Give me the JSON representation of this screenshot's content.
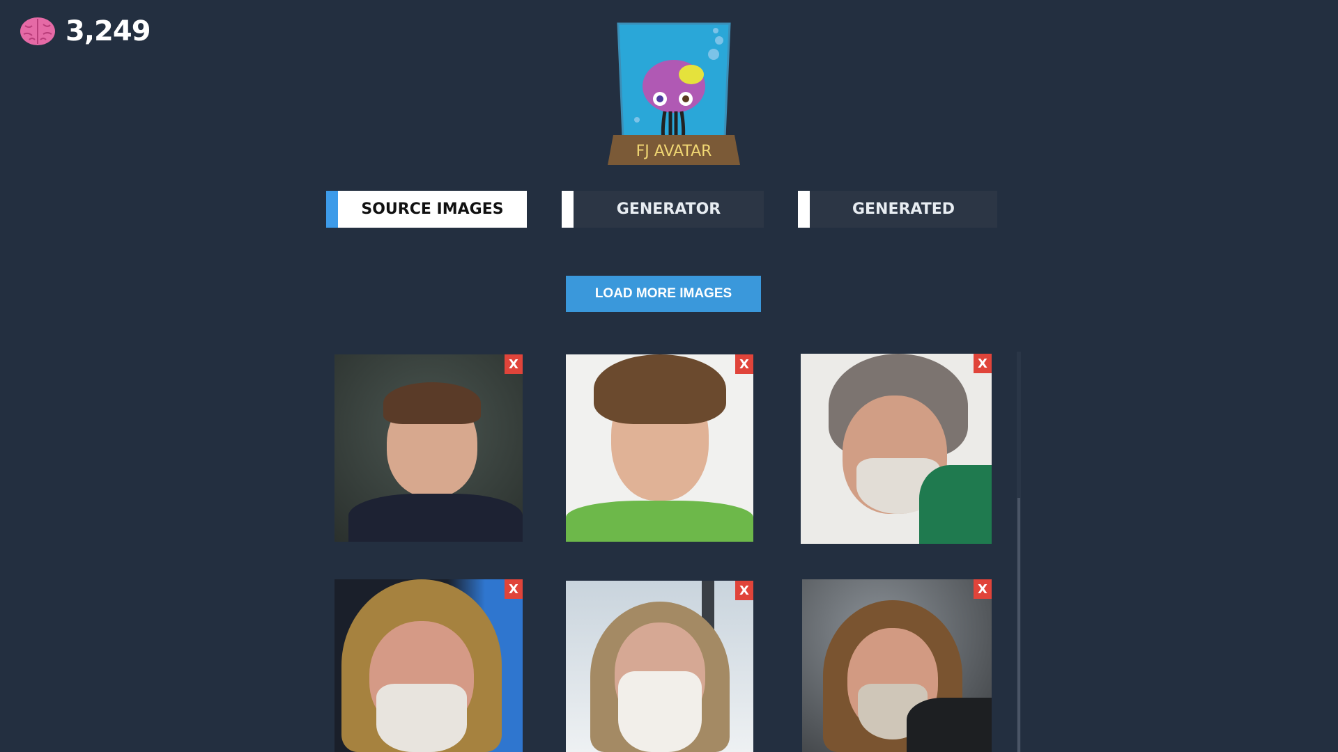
{
  "header": {
    "score": "3,249",
    "score_icon": "brain-icon",
    "logo_text": "FJ AVATAR"
  },
  "tabs": [
    {
      "label": "SOURCE IMAGES",
      "active": true
    },
    {
      "label": "GENERATOR",
      "active": false
    },
    {
      "label": "GENERATED",
      "active": false
    }
  ],
  "actions": {
    "load_more_label": "LOAD MORE IMAGES"
  },
  "images": [
    {
      "remove_label": "X",
      "description": "portrait, dark green background, navy polo"
    },
    {
      "remove_label": "X",
      "description": "portrait, white background, green polo"
    },
    {
      "remove_label": "X",
      "description": "portrait, grey beard, green shirt"
    },
    {
      "remove_label": "X",
      "description": "portrait, long hair, blue background"
    },
    {
      "remove_label": "X",
      "description": "portrait, white beard, window background"
    },
    {
      "remove_label": "X",
      "description": "portrait, speaking, dark background"
    }
  ],
  "colors": {
    "background": "#232f40",
    "accent": "#3a98db",
    "remove": "#e0443a",
    "tab_inactive": "#2c3645"
  }
}
